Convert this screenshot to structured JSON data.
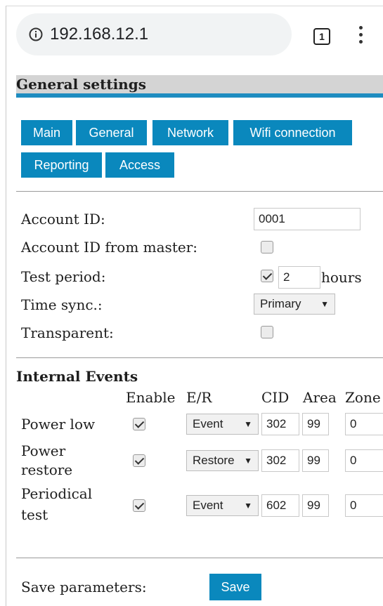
{
  "browser": {
    "url": "192.168.12.1",
    "tab_count": "1",
    "info_icon": "info-icon",
    "menu_icon": "kebab-menu-icon"
  },
  "section_title": "General settings",
  "tabs": [
    "Main",
    "General",
    "Network",
    "Wifi connection",
    "Reporting",
    "Access"
  ],
  "fields": {
    "account_id_label": "Account ID:",
    "account_id_value": "0001",
    "account_id_master_label": "Account ID from master:",
    "account_id_master_checked": false,
    "test_period_label": "Test period:",
    "test_period_checked": true,
    "test_period_value": "2",
    "test_period_unit": "hours",
    "time_sync_label": "Time sync.:",
    "time_sync_value": "Primary",
    "transparent_label": "Transparent:",
    "transparent_checked": false
  },
  "internal_events": {
    "title": "Internal Events",
    "headers": [
      "Enable",
      "E/R",
      "CID",
      "Area",
      "Zone"
    ],
    "rows": [
      {
        "label": "Power low",
        "enabled": true,
        "er": "Event",
        "cid": "302",
        "area": "99",
        "zone": "0"
      },
      {
        "label": "Power restore",
        "label_line1": "Power",
        "label_line2": "restore",
        "enabled": true,
        "er": "Restore",
        "cid": "302",
        "area": "99",
        "zone": "0"
      },
      {
        "label": "Periodical test",
        "label_line1": "Periodical",
        "label_line2": "test",
        "enabled": true,
        "er": "Event",
        "cid": "602",
        "area": "99",
        "zone": "0"
      }
    ]
  },
  "save": {
    "label": "Save parameters:",
    "button": "Save"
  },
  "colors": {
    "accent": "#0a88bd",
    "header_bg": "#d4d4d4"
  }
}
